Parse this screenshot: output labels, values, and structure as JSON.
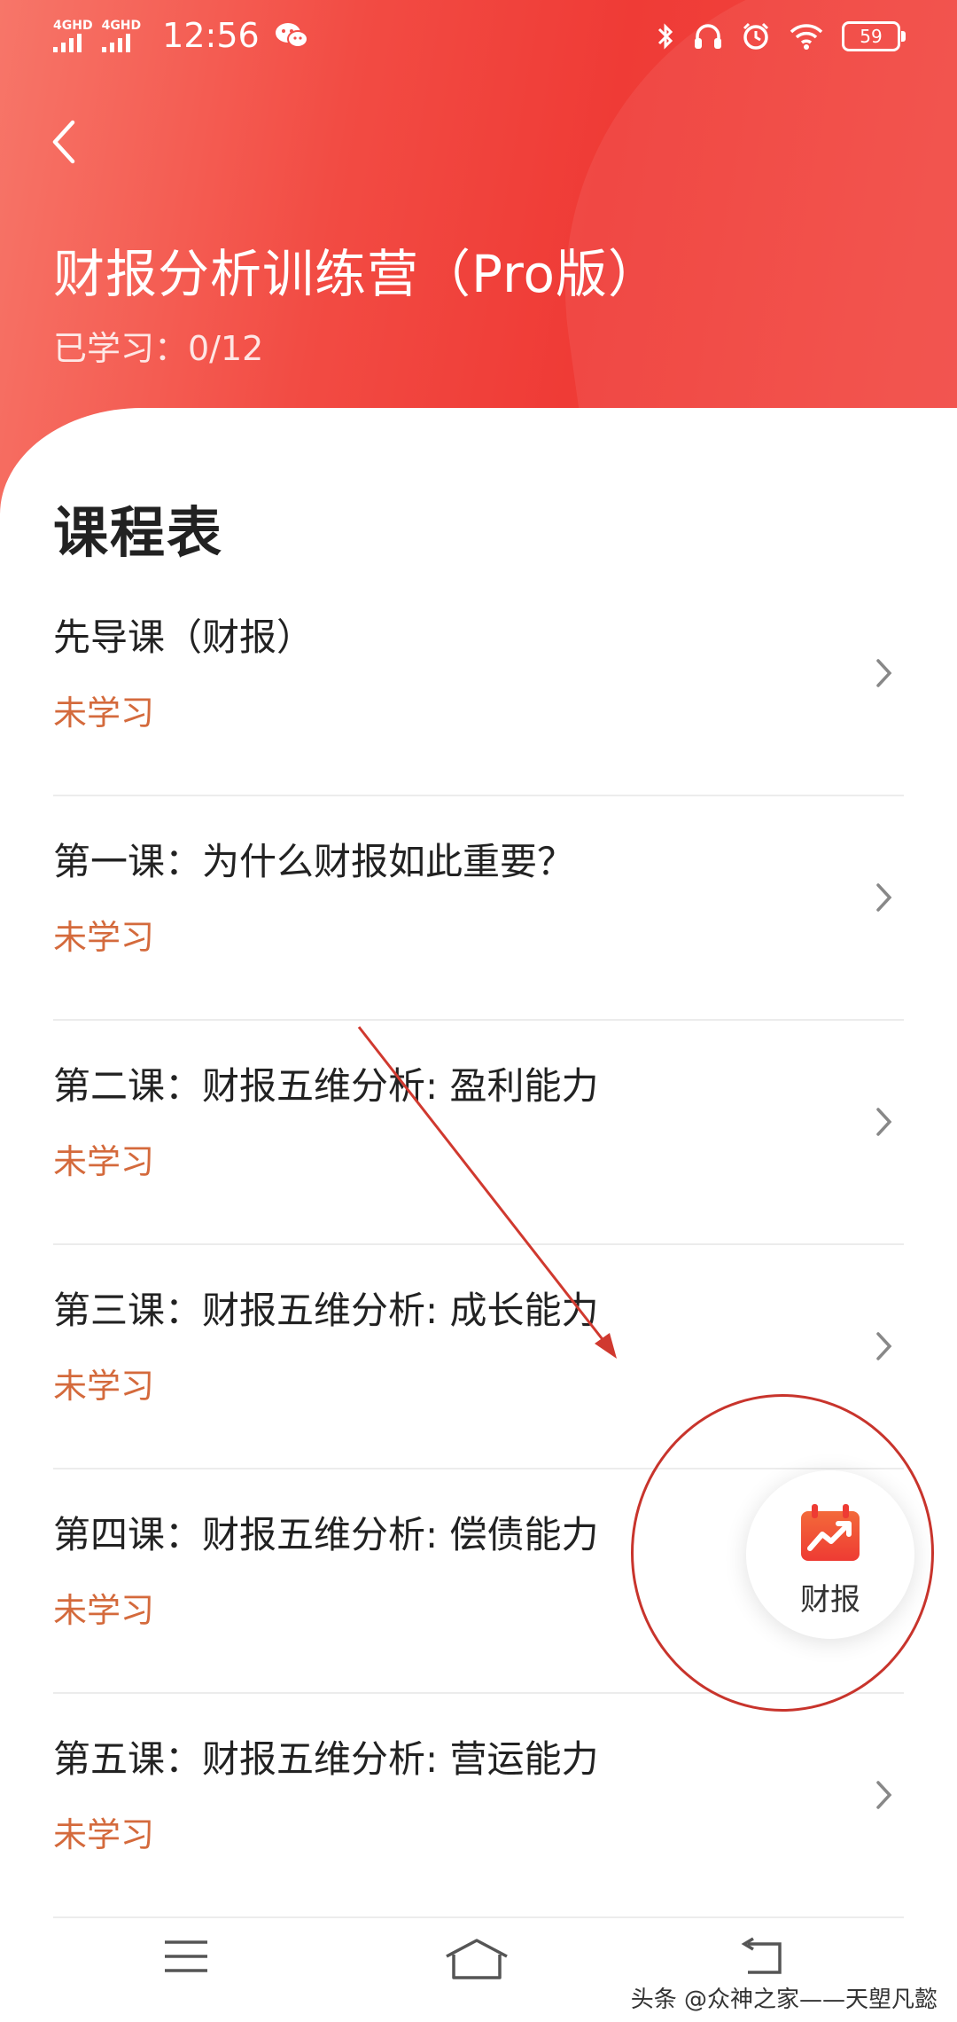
{
  "status_bar": {
    "network_1": "4GHD",
    "network_2": "4GHD",
    "time": "12:56",
    "battery": "59",
    "icons": [
      "wechat-icon",
      "bluetooth-icon",
      "headphones-icon",
      "alarm-icon",
      "wifi-icon",
      "battery-icon"
    ]
  },
  "header": {
    "title": "财报分析训练营（Pro版）",
    "progress": "已学习：0/12"
  },
  "schedule": {
    "title": "课程表",
    "lessons": [
      {
        "name": "先导课（财报）",
        "status": "未学习"
      },
      {
        "name": "第一课：为什么财报如此重要？",
        "status": "未学习"
      },
      {
        "name": "第二课：财报五维分析: 盈利能力",
        "status": "未学习"
      },
      {
        "name": "第三课：财报五维分析: 成长能力",
        "status": "未学习"
      },
      {
        "name": "第四课：财报五维分析: 偿债能力",
        "status": "未学习"
      },
      {
        "name": "第五课：财报五维分析: 营运能力",
        "status": "未学习"
      }
    ]
  },
  "fab": {
    "label": "财报",
    "icon": "financial-report-icon"
  },
  "watermark": "头条 @众神之家——天塱凡懿",
  "colors": {
    "header_red": "#ef3b36",
    "status_text": "#d46a3c",
    "annotation": "#c8342c"
  }
}
